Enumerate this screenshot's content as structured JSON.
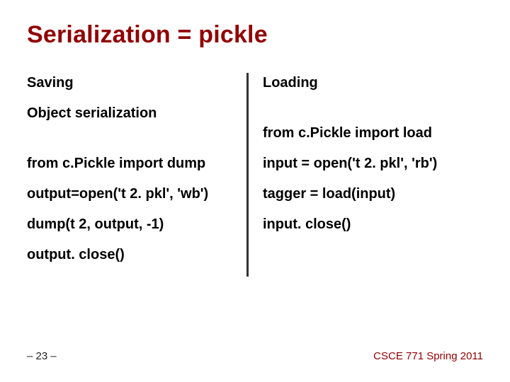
{
  "title": "Serialization = pickle",
  "left": {
    "h1": "Saving",
    "h2": "Object serialization",
    "l1": "from c.Pickle import dump",
    "l2": "output=open('t 2. pkl', 'wb')",
    "l3": "dump(t 2, output, -1)",
    "l4": "output. close()"
  },
  "right": {
    "h1": "Loading",
    "l0": "from c.Pickle import load",
    "l1": "input = open('t 2. pkl', 'rb')",
    "l2": "tagger = load(input)",
    "l3": "input. close()"
  },
  "footer": {
    "page": "– 23 –",
    "course": "CSCE 771 Spring 2011"
  }
}
